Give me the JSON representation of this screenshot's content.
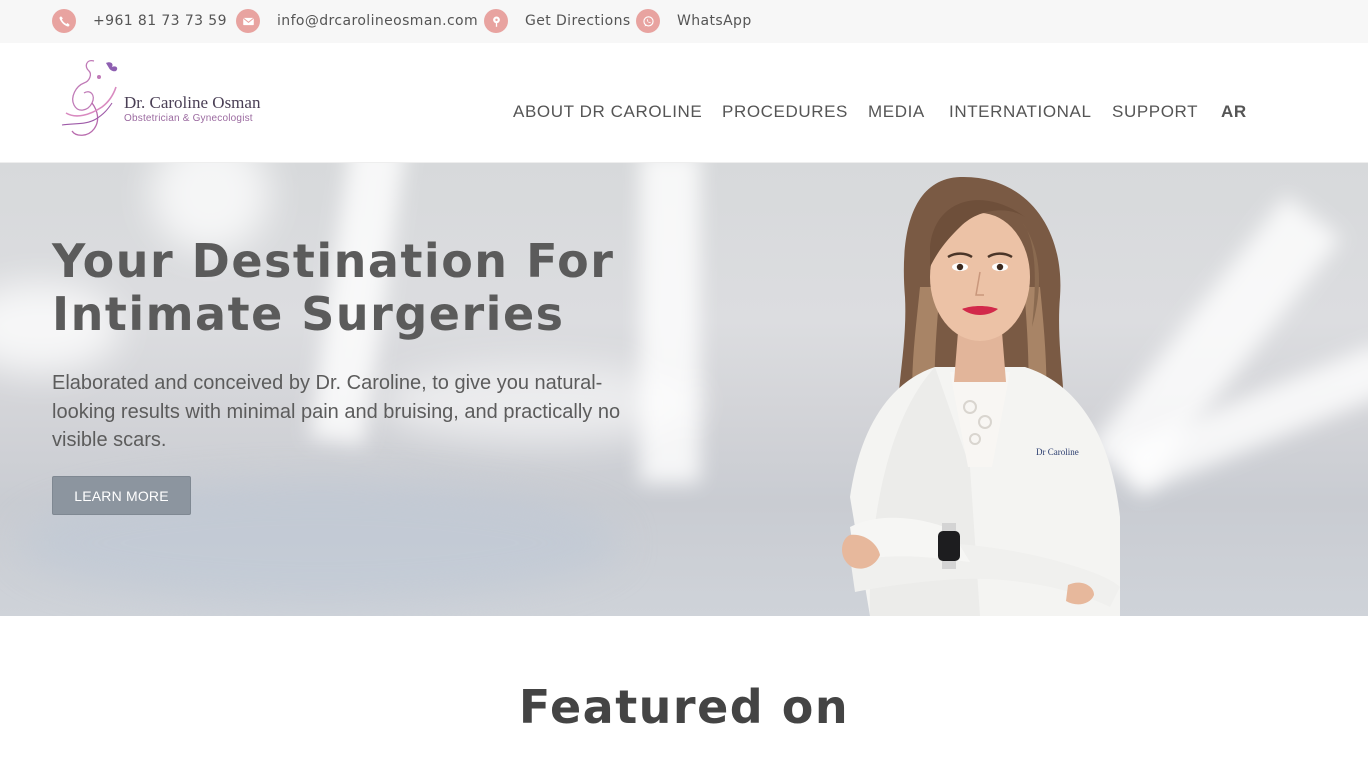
{
  "topbar": {
    "phone": "+961 81 73 73 59",
    "email": "info@drcarolineosman.com",
    "directions": "Get Directions",
    "whatsapp": "WhatsApp",
    "icon_color": "#e8a3a0"
  },
  "logo": {
    "name": "Dr. Caroline Osman",
    "subtitle": "Obstetrician & Gynecologist"
  },
  "nav": {
    "items": [
      "ABOUT DR CAROLINE",
      "PROCEDURES",
      "MEDIA",
      "INTERNATIONAL",
      "SUPPORT",
      "AR"
    ]
  },
  "hero": {
    "title": "Your Destination For Intimate Surgeries",
    "text": "Elaborated and conceived by Dr. Caroline, to give you natural-looking results with minimal pain and bruising, and practically no visible scars.",
    "button": "LEARN MORE",
    "coat_label": "Dr Caroline"
  },
  "featured": {
    "title": "Featured on"
  }
}
